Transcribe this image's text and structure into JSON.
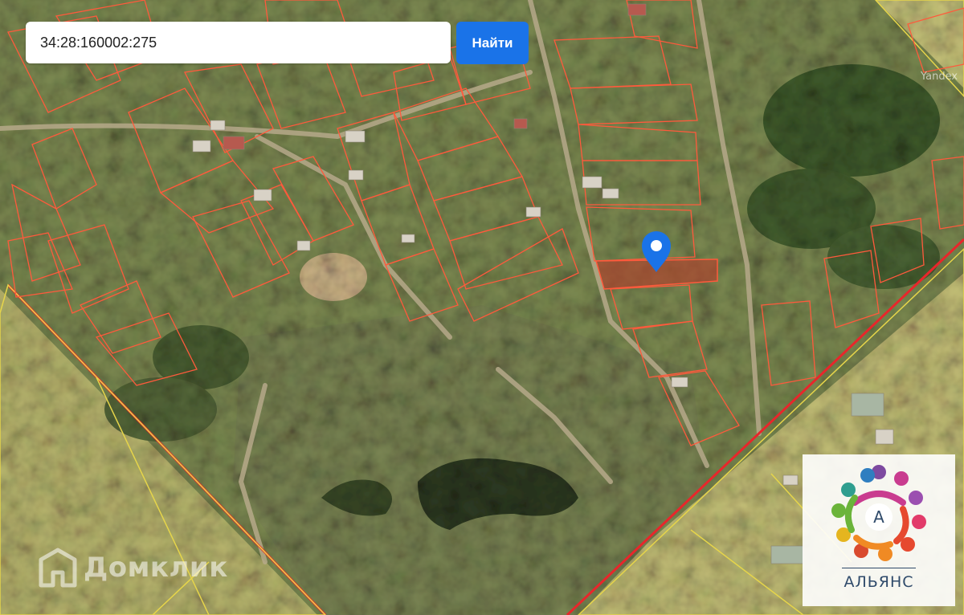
{
  "search": {
    "value": "34:28:160002:275",
    "button_label": "Найти"
  },
  "map": {
    "provider_mark": "Yandex",
    "selected_marker_icon": "map-pin-icon",
    "colors": {
      "parcel_outline": "#ff5a3c",
      "selected_parcel_fill": "#b53a2a",
      "road_red": "#e8262b",
      "field_outline": "#e6d54a",
      "marker": "#1a73e8"
    }
  },
  "watermark": {
    "domclick_text": "Домклик",
    "domclick_icon": "house-logo-icon"
  },
  "agency_logo": {
    "letter": "А",
    "name": "АЛЬЯНС"
  }
}
